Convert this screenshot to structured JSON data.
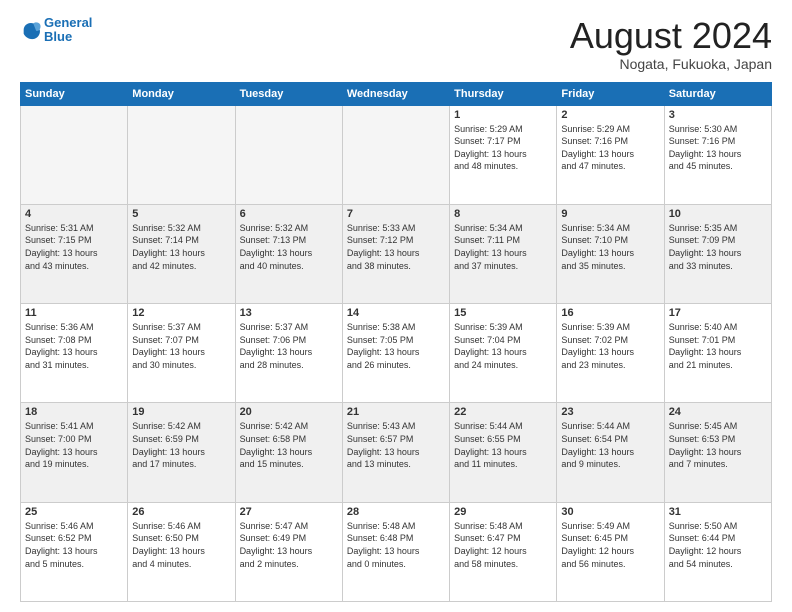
{
  "header": {
    "logo_line1": "General",
    "logo_line2": "Blue",
    "month": "August 2024",
    "location": "Nogata, Fukuoka, Japan"
  },
  "weekdays": [
    "Sunday",
    "Monday",
    "Tuesday",
    "Wednesday",
    "Thursday",
    "Friday",
    "Saturday"
  ],
  "weeks": [
    [
      {
        "day": "",
        "info": ""
      },
      {
        "day": "",
        "info": ""
      },
      {
        "day": "",
        "info": ""
      },
      {
        "day": "",
        "info": ""
      },
      {
        "day": "1",
        "info": "Sunrise: 5:29 AM\nSunset: 7:17 PM\nDaylight: 13 hours\nand 48 minutes."
      },
      {
        "day": "2",
        "info": "Sunrise: 5:29 AM\nSunset: 7:16 PM\nDaylight: 13 hours\nand 47 minutes."
      },
      {
        "day": "3",
        "info": "Sunrise: 5:30 AM\nSunset: 7:16 PM\nDaylight: 13 hours\nand 45 minutes."
      }
    ],
    [
      {
        "day": "4",
        "info": "Sunrise: 5:31 AM\nSunset: 7:15 PM\nDaylight: 13 hours\nand 43 minutes."
      },
      {
        "day": "5",
        "info": "Sunrise: 5:32 AM\nSunset: 7:14 PM\nDaylight: 13 hours\nand 42 minutes."
      },
      {
        "day": "6",
        "info": "Sunrise: 5:32 AM\nSunset: 7:13 PM\nDaylight: 13 hours\nand 40 minutes."
      },
      {
        "day": "7",
        "info": "Sunrise: 5:33 AM\nSunset: 7:12 PM\nDaylight: 13 hours\nand 38 minutes."
      },
      {
        "day": "8",
        "info": "Sunrise: 5:34 AM\nSunset: 7:11 PM\nDaylight: 13 hours\nand 37 minutes."
      },
      {
        "day": "9",
        "info": "Sunrise: 5:34 AM\nSunset: 7:10 PM\nDaylight: 13 hours\nand 35 minutes."
      },
      {
        "day": "10",
        "info": "Sunrise: 5:35 AM\nSunset: 7:09 PM\nDaylight: 13 hours\nand 33 minutes."
      }
    ],
    [
      {
        "day": "11",
        "info": "Sunrise: 5:36 AM\nSunset: 7:08 PM\nDaylight: 13 hours\nand 31 minutes."
      },
      {
        "day": "12",
        "info": "Sunrise: 5:37 AM\nSunset: 7:07 PM\nDaylight: 13 hours\nand 30 minutes."
      },
      {
        "day": "13",
        "info": "Sunrise: 5:37 AM\nSunset: 7:06 PM\nDaylight: 13 hours\nand 28 minutes."
      },
      {
        "day": "14",
        "info": "Sunrise: 5:38 AM\nSunset: 7:05 PM\nDaylight: 13 hours\nand 26 minutes."
      },
      {
        "day": "15",
        "info": "Sunrise: 5:39 AM\nSunset: 7:04 PM\nDaylight: 13 hours\nand 24 minutes."
      },
      {
        "day": "16",
        "info": "Sunrise: 5:39 AM\nSunset: 7:02 PM\nDaylight: 13 hours\nand 23 minutes."
      },
      {
        "day": "17",
        "info": "Sunrise: 5:40 AM\nSunset: 7:01 PM\nDaylight: 13 hours\nand 21 minutes."
      }
    ],
    [
      {
        "day": "18",
        "info": "Sunrise: 5:41 AM\nSunset: 7:00 PM\nDaylight: 13 hours\nand 19 minutes."
      },
      {
        "day": "19",
        "info": "Sunrise: 5:42 AM\nSunset: 6:59 PM\nDaylight: 13 hours\nand 17 minutes."
      },
      {
        "day": "20",
        "info": "Sunrise: 5:42 AM\nSunset: 6:58 PM\nDaylight: 13 hours\nand 15 minutes."
      },
      {
        "day": "21",
        "info": "Sunrise: 5:43 AM\nSunset: 6:57 PM\nDaylight: 13 hours\nand 13 minutes."
      },
      {
        "day": "22",
        "info": "Sunrise: 5:44 AM\nSunset: 6:55 PM\nDaylight: 13 hours\nand 11 minutes."
      },
      {
        "day": "23",
        "info": "Sunrise: 5:44 AM\nSunset: 6:54 PM\nDaylight: 13 hours\nand 9 minutes."
      },
      {
        "day": "24",
        "info": "Sunrise: 5:45 AM\nSunset: 6:53 PM\nDaylight: 13 hours\nand 7 minutes."
      }
    ],
    [
      {
        "day": "25",
        "info": "Sunrise: 5:46 AM\nSunset: 6:52 PM\nDaylight: 13 hours\nand 5 minutes."
      },
      {
        "day": "26",
        "info": "Sunrise: 5:46 AM\nSunset: 6:50 PM\nDaylight: 13 hours\nand 4 minutes."
      },
      {
        "day": "27",
        "info": "Sunrise: 5:47 AM\nSunset: 6:49 PM\nDaylight: 13 hours\nand 2 minutes."
      },
      {
        "day": "28",
        "info": "Sunrise: 5:48 AM\nSunset: 6:48 PM\nDaylight: 13 hours\nand 0 minutes."
      },
      {
        "day": "29",
        "info": "Sunrise: 5:48 AM\nSunset: 6:47 PM\nDaylight: 12 hours\nand 58 minutes."
      },
      {
        "day": "30",
        "info": "Sunrise: 5:49 AM\nSunset: 6:45 PM\nDaylight: 12 hours\nand 56 minutes."
      },
      {
        "day": "31",
        "info": "Sunrise: 5:50 AM\nSunset: 6:44 PM\nDaylight: 12 hours\nand 54 minutes."
      }
    ]
  ]
}
